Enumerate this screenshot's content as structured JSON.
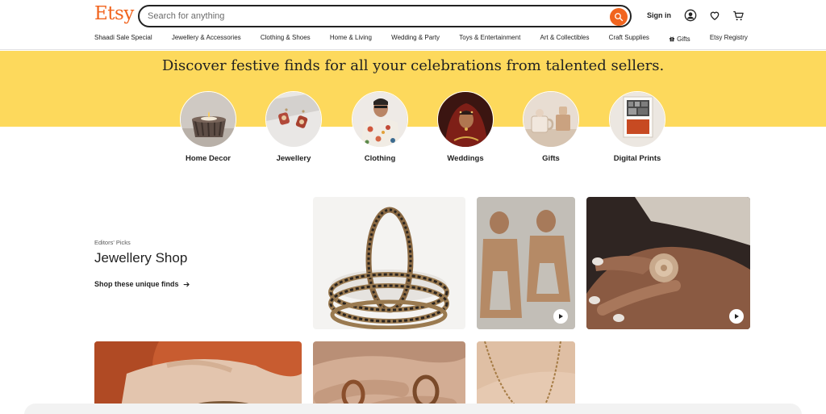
{
  "header": {
    "logo": "Etsy",
    "search_placeholder": "Search for anything",
    "sign_in": "Sign in"
  },
  "nav": {
    "items": [
      {
        "label": "Shaadi Sale Special"
      },
      {
        "label": "Jewellery & Accessories"
      },
      {
        "label": "Clothing & Shoes"
      },
      {
        "label": "Home & Living"
      },
      {
        "label": "Wedding & Party"
      },
      {
        "label": "Toys & Entertainment"
      },
      {
        "label": "Art & Collectibles"
      },
      {
        "label": "Craft Supplies"
      },
      {
        "label": "Gifts",
        "icon": "gift-icon"
      },
      {
        "label": "Etsy Registry"
      }
    ]
  },
  "hero": {
    "title": "Discover festive finds for all your celebrations from talented sellers.",
    "background": "#fdd95c",
    "categories": [
      {
        "label": "Home Decor"
      },
      {
        "label": "Jewellery"
      },
      {
        "label": "Clothing"
      },
      {
        "label": "Weddings"
      },
      {
        "label": "Gifts"
      },
      {
        "label": "Digital Prints"
      }
    ]
  },
  "editors_picks": {
    "eyebrow": "Editors' Picks",
    "title": "Jewellery Shop",
    "link": "Shop these unique finds",
    "link_icon": "arrow-right-icon"
  },
  "colors": {
    "accent": "#f1641e",
    "text": "#222222"
  }
}
